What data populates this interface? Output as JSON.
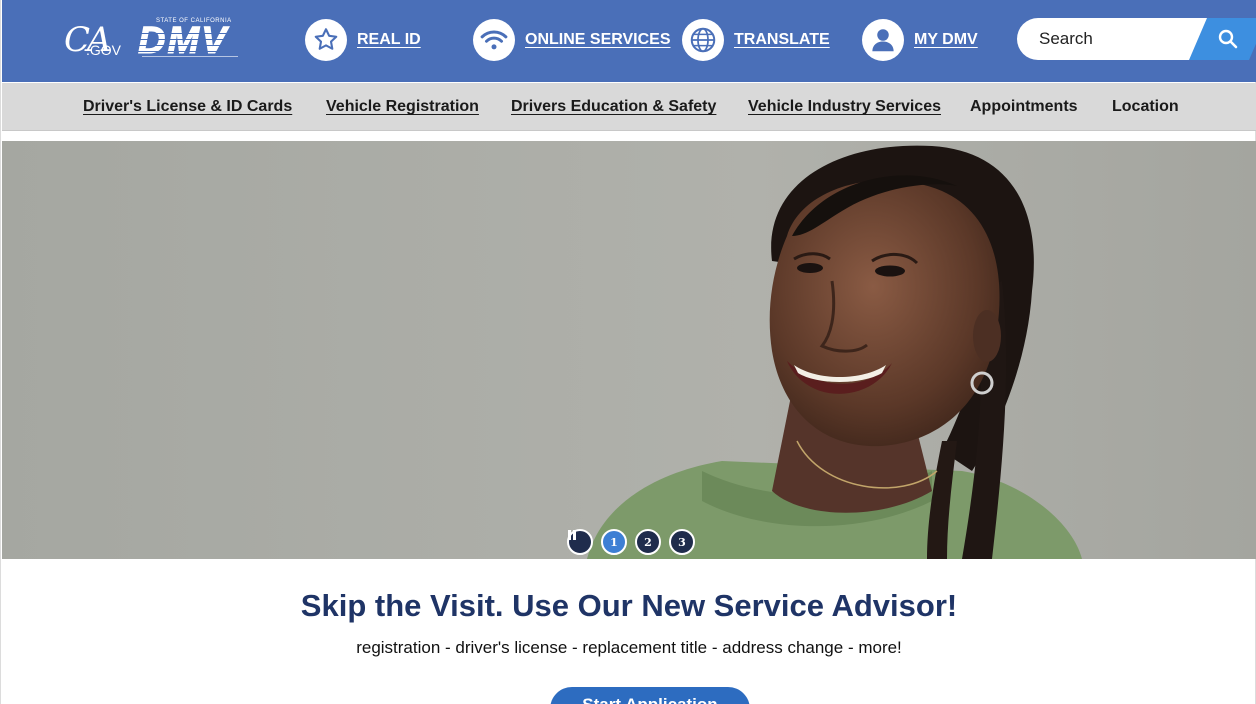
{
  "header": {
    "ca_logo": {
      "script": "CA",
      "gov": ".GOV"
    },
    "dmv_logo": {
      "state_line": "STATE OF CALIFORNIA",
      "word": "DMV"
    },
    "links": [
      {
        "label": "REAL ID",
        "icon": "star-icon"
      },
      {
        "label": "ONLINE SERVICES",
        "icon": "wifi-icon"
      },
      {
        "label": "TRANSLATE",
        "icon": "globe-icon"
      },
      {
        "label": "MY DMV",
        "icon": "user-icon"
      }
    ],
    "search": {
      "placeholder": "Search",
      "icon": "search-icon"
    }
  },
  "nav": {
    "items": [
      {
        "label": "Driver's License & ID Cards"
      },
      {
        "label": "Vehicle Registration"
      },
      {
        "label": "Drivers Education & Safety"
      },
      {
        "label": "Vehicle Industry Services"
      },
      {
        "label": "Appointments"
      },
      {
        "label": "Location"
      }
    ]
  },
  "carousel": {
    "pause_icon": "pause-icon",
    "slides": [
      "1",
      "2",
      "3"
    ],
    "active_slide": 1
  },
  "promo": {
    "title": "Skip the Visit. Use Our New Service Advisor!",
    "subtitle": "registration - driver's license - replacement title - address change - more!",
    "button_label": "Start Application"
  },
  "colors": {
    "header_bg": "#4a6fb8",
    "nav_bg": "#d9d9d9",
    "title_color": "#1f3466",
    "accent": "#3d8fe0"
  }
}
